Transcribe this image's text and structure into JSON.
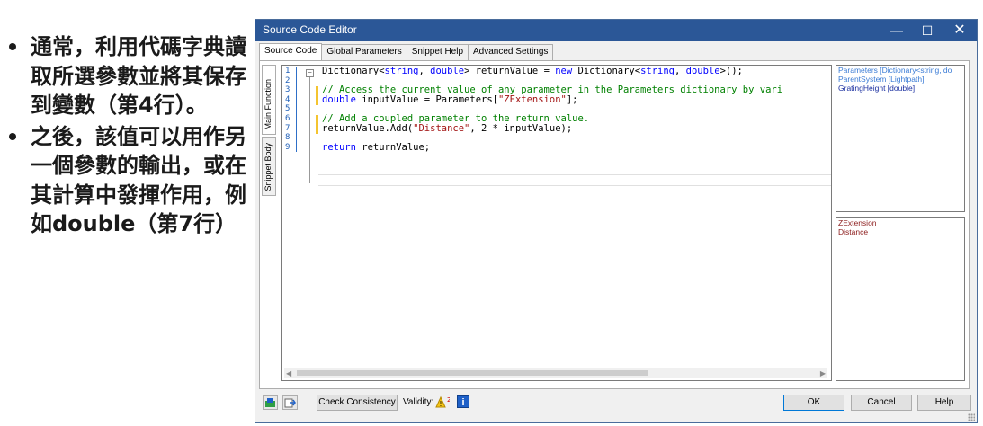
{
  "slide": {
    "bullets": [
      "通常，利用代碼字典讀取所選參數並將其保存到變數（第4行）。",
      "之後，該值可以用作另一個參數的輸出，或在其計算中發揮作用，例如double（第7行）"
    ]
  },
  "window": {
    "title": "Source Code Editor",
    "controls": {
      "minimize": "—",
      "maximize": "☐",
      "close": "✕"
    }
  },
  "tabs": [
    "Source Code",
    "Global Parameters",
    "Snippet Help",
    "Advanced Settings"
  ],
  "side_tabs": [
    "Main Function",
    "Snippet Body"
  ],
  "editor": {
    "line_numbers": [
      "1",
      "2",
      "3",
      "4",
      "5",
      "6",
      "7",
      "8",
      "9"
    ],
    "lines": [
      [
        {
          "t": "Dictionary<"
        },
        {
          "t": "string",
          "c": "kw"
        },
        {
          "t": ", "
        },
        {
          "t": "double",
          "c": "kw"
        },
        {
          "t": "> returnValue = "
        },
        {
          "t": "new",
          "c": "kw"
        },
        {
          "t": " Dictionary<"
        },
        {
          "t": "string",
          "c": "kw"
        },
        {
          "t": ", "
        },
        {
          "t": "double",
          "c": "kw"
        },
        {
          "t": ">();"
        }
      ],
      [],
      [
        {
          "t": "// Access the current value of any parameter in the Parameters dictionary by vari",
          "c": "cm"
        }
      ],
      [
        {
          "t": "double",
          "c": "kw"
        },
        {
          "t": " inputValue = Parameters["
        },
        {
          "t": "\"ZExtension\"",
          "c": "st"
        },
        {
          "t": "];"
        }
      ],
      [],
      [
        {
          "t": "// Add a coupled parameter to the return value.",
          "c": "cm"
        }
      ],
      [
        {
          "t": "returnValue.Add("
        },
        {
          "t": "\"Distance\"",
          "c": "st"
        },
        {
          "t": ", 2 * inputValue);"
        }
      ],
      [],
      [
        {
          "t": "return",
          "c": "kw"
        },
        {
          "t": " returnValue;"
        }
      ]
    ]
  },
  "parameters": [
    {
      "text": "Parameters [Dictionary<string, do",
      "color": "#3a7bd5"
    },
    {
      "text": "ParentSystem [Lightpath]",
      "color": "#3a7bd5"
    },
    {
      "text": "GratingHeight [double]",
      "color": "#1a2fa0"
    }
  ],
  "outputs": [
    {
      "text": "ZExtension",
      "color": "#8b1a1a"
    },
    {
      "text": "Distance",
      "color": "#8b1a1a"
    }
  ],
  "footer": {
    "check_consistency": "Check Consistency",
    "validity_label": "Validity:",
    "warning_count": "2",
    "info": "i",
    "ok": "OK",
    "cancel": "Cancel",
    "help": "Help"
  },
  "colors": {
    "titlebar": "#2b5797",
    "accent": "#0078d7"
  }
}
